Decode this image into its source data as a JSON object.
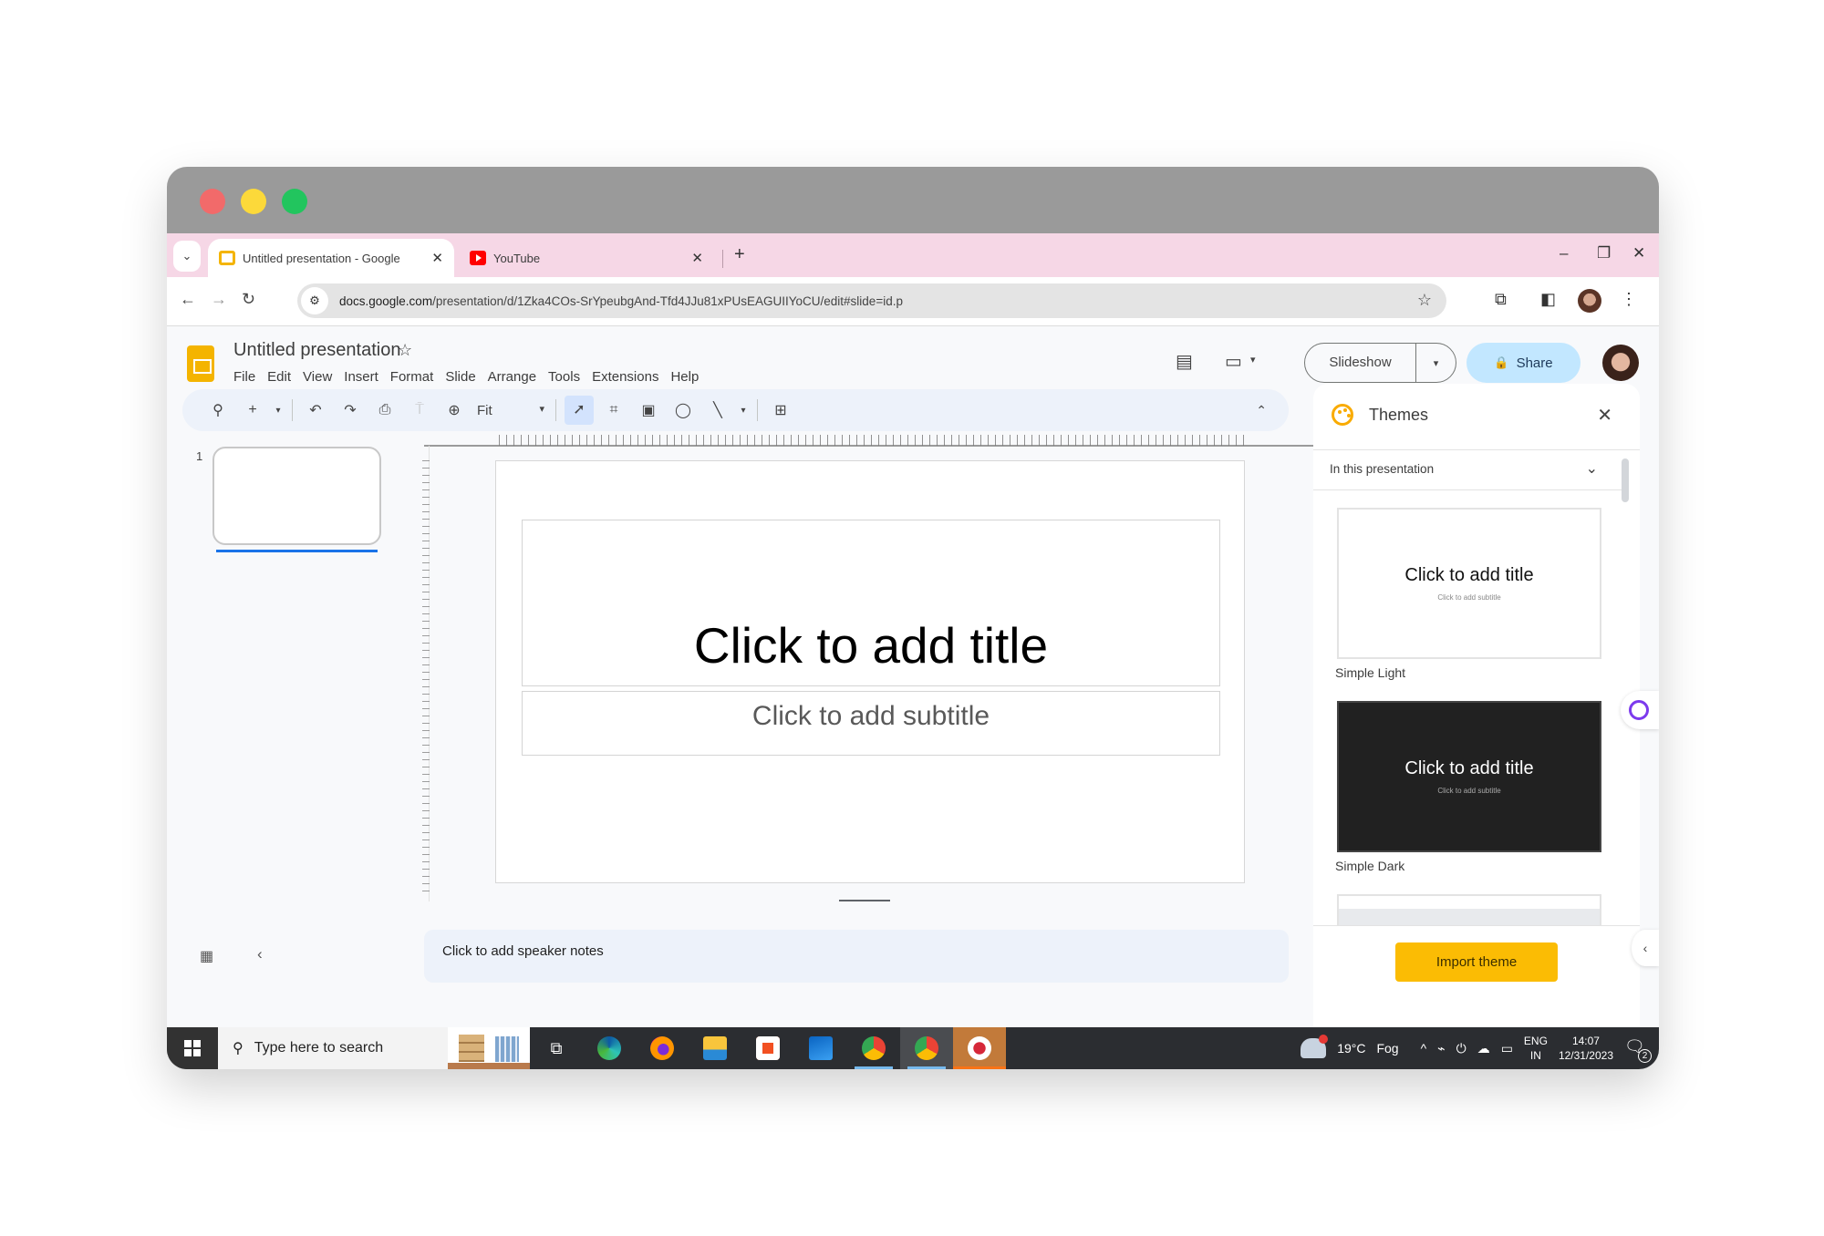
{
  "browser": {
    "tabs": [
      {
        "label": "Untitled presentation - Google",
        "favicon": "google-slides-icon",
        "active": true
      },
      {
        "label": "YouTube",
        "favicon": "youtube-icon",
        "active": false
      }
    ],
    "tab_close_glyph": "✕",
    "new_tab_glyph": "+",
    "tab_search_glyph": "⌄",
    "window_controls": {
      "minimize": "–",
      "restore": "❐",
      "close": "✕"
    },
    "nav": {
      "back": "←",
      "forward": "→",
      "reload": "↻"
    },
    "url": {
      "host": "docs.google.com",
      "path": "/presentation/d/1Zka4COs-SrYpeubgAnd-Tfd4JJu81xPUsEAGUIIYoCU/edit#slide=id.p"
    },
    "site_info_glyph": "⚙",
    "bookmark_glyph": "☆",
    "extensions_glyph": "⧉",
    "sidepanel_glyph": "◧",
    "menu_glyph": "⋮"
  },
  "app": {
    "title": "Untitled presentation",
    "star_glyph": "☆",
    "menu": [
      "File",
      "Edit",
      "View",
      "Insert",
      "Format",
      "Slide",
      "Arrange",
      "Tools",
      "Extensions",
      "Help"
    ],
    "comments_glyph": "▤",
    "meet_glyph": "▭",
    "meet_dropdown": "▾",
    "slideshow_label": "Slideshow",
    "slideshow_dropdown": "▾",
    "share_label": "Share",
    "share_glyph": "🔒"
  },
  "toolbar": {
    "search": "⚲",
    "new_slide": "+",
    "new_slide_dropdown": "▾",
    "undo": "↶",
    "redo": "↷",
    "print": "⎙",
    "paint_format": "⍑",
    "zoom_glyph": "⊕",
    "zoom_value": "Fit",
    "zoom_dropdown": "▾",
    "select": "➚",
    "text_box": "⌗",
    "image": "▣",
    "shape": "◯",
    "line": "╲",
    "line_dropdown": "▾",
    "comment": "⊞",
    "collapse": "⌃"
  },
  "filmstrip": {
    "slide_number": "1"
  },
  "slide": {
    "title_placeholder": "Click to add title",
    "subtitle_placeholder": "Click to add subtitle"
  },
  "notes": {
    "placeholder": "Click to add speaker notes"
  },
  "bottom": {
    "grid_glyph": "▦",
    "collapse_glyph": "‹"
  },
  "themes": {
    "title": "Themes",
    "close_glyph": "✕",
    "filter": "In this presentation",
    "filter_chevron": "⌄",
    "cards": [
      {
        "name": "Simple Light",
        "title": "Click to add title",
        "subtitle": "Click to add subtitle"
      },
      {
        "name": "Simple Dark",
        "title": "Click to add title",
        "subtitle": "Click to add subtitle"
      }
    ],
    "import_label": "Import theme",
    "expand_glyph": "‹"
  },
  "taskbar": {
    "search_placeholder": "Type here to search",
    "search_glyph": "⚲",
    "task_view_glyph": "⧉",
    "weather_temp": "19°C",
    "weather_desc": "Fog",
    "tray_chevron": "^",
    "tray_icons": [
      "⌁",
      "⏻",
      "☁",
      "▭"
    ],
    "lang_top": "ENG",
    "lang_bottom": "IN",
    "time": "14:07",
    "date": "12/31/2023",
    "notification_glyph": "🗨",
    "notification_count": "2"
  },
  "colors": {
    "tabstrip": "#f6d7e6",
    "titlebar": "#9a9a9a",
    "accent_blue": "#1a73e8",
    "share_bg": "#c2e7ff",
    "import_bg": "#fbbc04",
    "slides_yellow": "#f4b400"
  }
}
